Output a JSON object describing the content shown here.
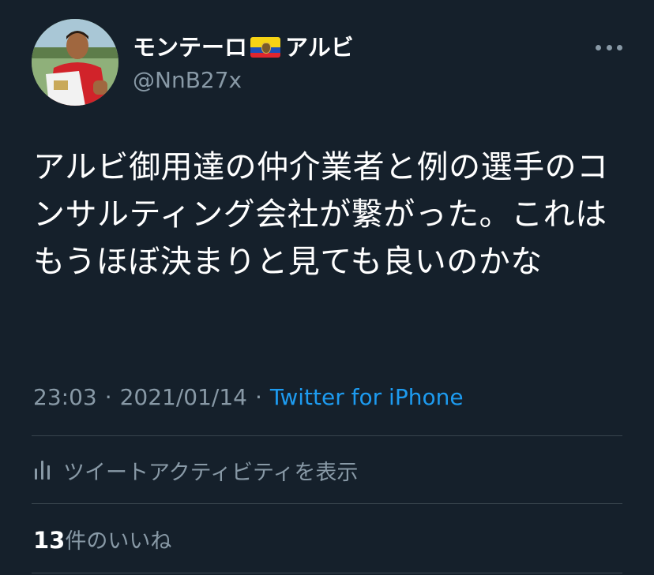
{
  "user": {
    "display_name": "モンテーロ",
    "display_name_suffix": "アルビ",
    "flag": "ecuador-flag",
    "handle": "@NnB27x"
  },
  "tweet": {
    "text": "アルビ御用達の仲介業者と例の選手のコンサルティング会社が繋がった。これはもうほぼ決まりと見ても良いのかな",
    "time": "23:03",
    "date": "2021/01/14",
    "separator": "·",
    "source": "Twitter for iPhone"
  },
  "activity": {
    "label": "ツイートアクティビティを表示"
  },
  "likes": {
    "count": "13",
    "label": "件のいいね"
  },
  "colors": {
    "background": "#15202b",
    "text_primary": "#ffffff",
    "text_secondary": "#8899a6",
    "link": "#1d9bf0",
    "divider": "#38444d"
  }
}
